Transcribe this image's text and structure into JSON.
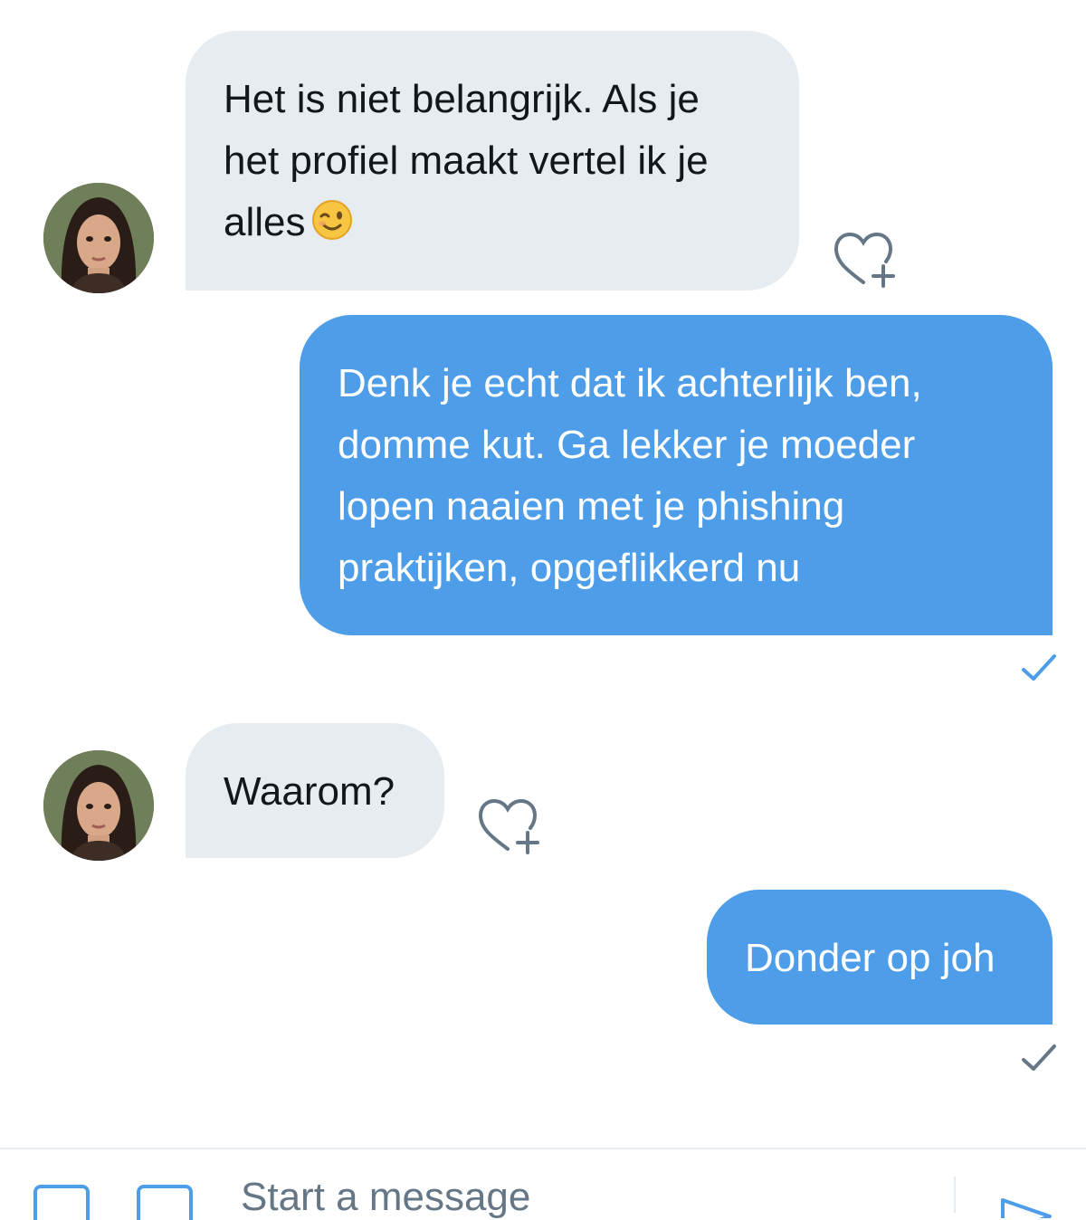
{
  "messages": [
    {
      "direction": "incoming",
      "text": "Het is niet belangrijk. Als je het profiel maakt vertel ik je alles",
      "lines": [
        "Het is niet belangrijk. Als je",
        "het profiel maakt vertel ik je",
        "alles"
      ],
      "emoji": "winking-face-emoji"
    },
    {
      "direction": "outgoing",
      "text": "Denk je echt dat ik achterlijk ben, domme kut. Ga lekker je moeder lopen naaien met je phishing praktijken, opgeflikkerd nu",
      "lines": [
        "Denk je echt dat ik achterlijk ben,",
        "domme kut. Ga lekker je moeder",
        "lopen naaien met je phishing",
        "praktijken, opgeflikkerd nu"
      ],
      "status": "read"
    },
    {
      "direction": "incoming",
      "text": "Waarom?",
      "lines": [
        "Waarom?"
      ]
    },
    {
      "direction": "outgoing",
      "text": "Donder op joh",
      "lines": [
        "Donder op joh"
      ],
      "status": "sent"
    }
  ],
  "composer": {
    "placeholder": "Start a message"
  },
  "colors": {
    "incoming_bubble": "#e6ecf0",
    "outgoing_bubble": "#4d9de9",
    "read_check": "#4d9de9",
    "sent_check": "#657786"
  },
  "icons": [
    "heart-plus-icon",
    "checkmark-icon",
    "media-icon",
    "gif-icon",
    "send-icon",
    "winking-face-emoji"
  ]
}
